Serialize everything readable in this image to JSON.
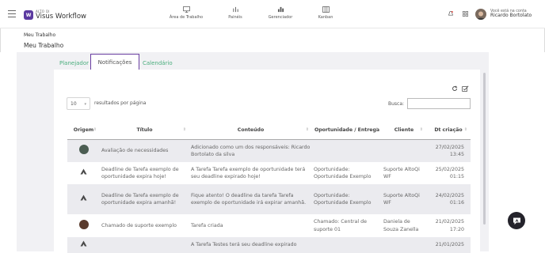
{
  "app": {
    "brand_top": "ALTO QI",
    "brand_name": "Visus Workflow"
  },
  "nav": [
    {
      "label": "Área de Trabalho",
      "icon": "monitor-icon"
    },
    {
      "label": "Painéis",
      "icon": "bar-chart-icon"
    },
    {
      "label": "Gerenciador",
      "icon": "chart-icon"
    },
    {
      "label": "Kanban",
      "icon": "kanban-icon"
    }
  ],
  "account": {
    "line1": "Você está na conta",
    "name": "Ricardo Bortolato"
  },
  "breadcrumb": "Meu Trabalho",
  "page_title": "Meu Trabalho",
  "tabs": [
    {
      "label": "Planejador"
    },
    {
      "label": "Notificações",
      "active": true
    },
    {
      "label": "Calendário"
    }
  ],
  "table_controls": {
    "page_length": "10",
    "page_length_label": "resultados por página",
    "search_label": "Busca:",
    "search_value": ""
  },
  "columns": [
    "Origem",
    "Título",
    "Conteúdo",
    "Oportunidade / Entrega",
    "Cliente",
    "Dt criação"
  ],
  "rows": [
    {
      "origem": "avatar",
      "titulo": "Avaliação de necessidades",
      "conteudo": "Adicionado como um dos responsáveis: Ricardo Bortolato da silva",
      "oportunidade": "",
      "cliente": "",
      "data": "27/02/2025 13:45"
    },
    {
      "origem": "alto-logo",
      "titulo": "Deadline de Tarefa exemplo de oportunidade expira hoje!",
      "conteudo": "A Tarefa Tarefa exemplo de oportunidade terá seu deadline expirado hoje!",
      "oportunidade": "Oportunidade: Oportunidade Exemplo",
      "cliente": "Suporte AltoQi WF",
      "data": "25/02/2025 01:15"
    },
    {
      "origem": "alto-logo",
      "titulo": "Deadline de Tarefa exemplo de oportunidade expira amanhã!",
      "conteudo": "Fique atento! O deadline da tarefa Tarefa exemplo de oportunidade irá expirar amanhã.",
      "oportunidade": "Oportunidade: Oportunidade Exemplo",
      "cliente": "Suporte AltoQi WF",
      "data": "24/02/2025 01:16"
    },
    {
      "origem": "avatar",
      "titulo": "Chamado de suporte exemplo",
      "conteudo": "Tarefa criada",
      "oportunidade": "Chamado: Central de suporte 01",
      "cliente": "Daniela de Souza Zanella",
      "data": "21/02/2025 17:20"
    },
    {
      "origem": "alto-logo",
      "titulo": "",
      "conteudo": "A Tarefa Testes terá seu deadline expirado",
      "oportunidade": "",
      "cliente": "",
      "data": "21/01/2025"
    }
  ],
  "colors": {
    "accent": "#6a3ea1",
    "tab_link": "#4bae7d",
    "stripe": "#ebebef"
  }
}
